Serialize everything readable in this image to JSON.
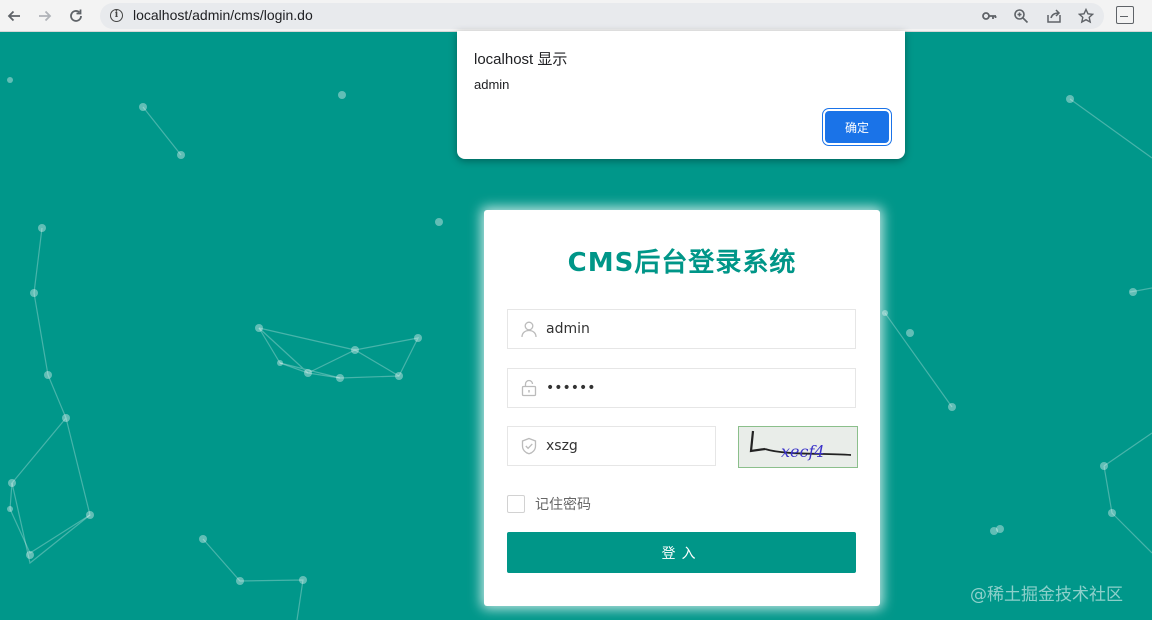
{
  "browser": {
    "url": "localhost/admin/cms/login.do",
    "icons": [
      "back-arrow-icon",
      "forward-arrow-icon",
      "reload-icon",
      "info-icon",
      "key-icon",
      "zoom-icon",
      "share-icon",
      "star-icon",
      "extension-icon"
    ]
  },
  "dialog": {
    "title": "localhost 显示",
    "message": "admin",
    "ok_label": "确定"
  },
  "login": {
    "title": "CMS后台登录系统",
    "username_value": "admin",
    "password_value": "••••••",
    "captcha_value": "xszg",
    "captcha_image_text": "xecf4",
    "remember_label": "记住密码",
    "remember_checked": false,
    "submit_label": "登入"
  },
  "watermark": "@稀土掘金技术社区",
  "colors": {
    "background": "#00978a",
    "accent": "#009688",
    "dialog_button": "#1a73e8"
  }
}
